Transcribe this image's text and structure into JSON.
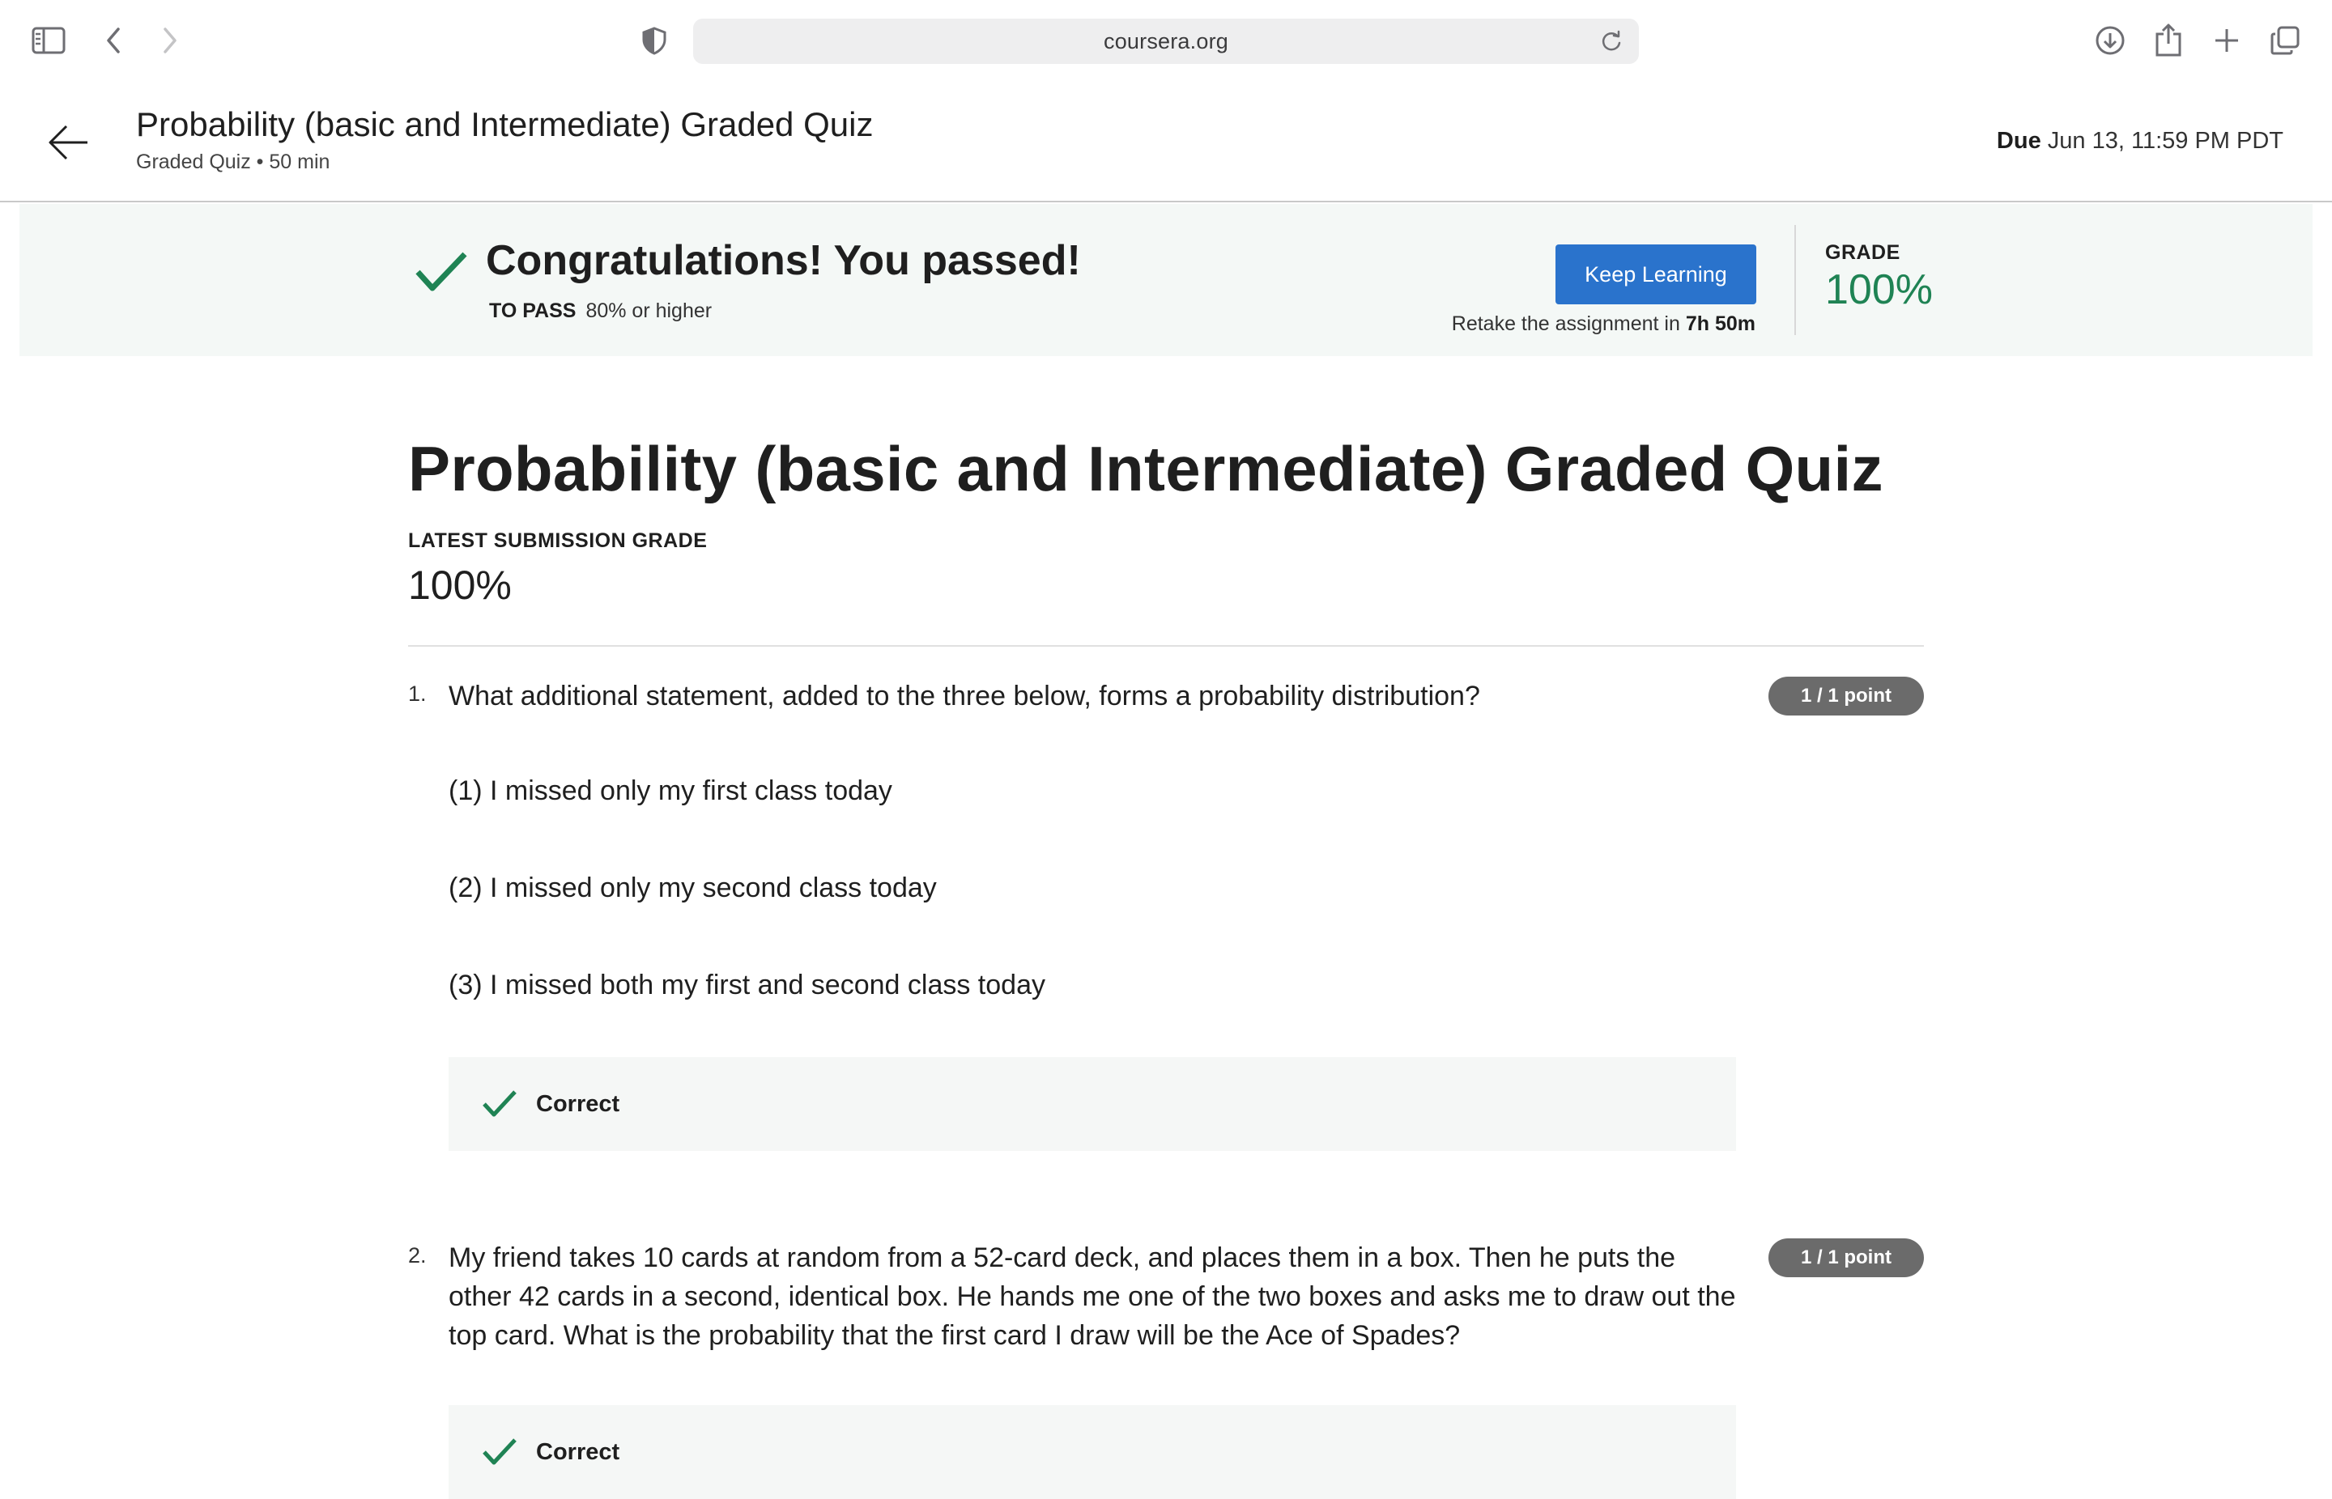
{
  "browser": {
    "url": "coursera.org",
    "icons": [
      "sidebar-icon",
      "back-icon",
      "forward-icon",
      "shield-icon",
      "reload-icon",
      "download-icon",
      "share-icon",
      "new-tab-icon",
      "tabs-overview-icon"
    ]
  },
  "header": {
    "title": "Probability (basic and Intermediate) Graded Quiz",
    "subtitle": "Graded Quiz • 50 min",
    "due_label": "Due",
    "due_value": "Jun 13, 11:59 PM PDT"
  },
  "banner": {
    "title": "Congratulations! You passed!",
    "to_pass_label": "TO PASS",
    "to_pass_value": "80% or higher",
    "button_label": "Keep Learning",
    "retake_text": "Retake the assignment in",
    "retake_time": "7h 50m",
    "grade_label": "GRADE",
    "grade_value": "100%",
    "accent_color": "#1f8354",
    "button_color": "#2a73cc"
  },
  "main": {
    "title": "Probability (basic and Intermediate) Graded Quiz",
    "latest_label": "LATEST SUBMISSION GRADE",
    "latest_value": "100%"
  },
  "questions": [
    {
      "number": "1.",
      "text": "What additional statement, added to the three below, forms a probability distribution?",
      "points": "1 / 1 point",
      "options": [
        "(1) I missed only my first class today",
        "(2) I missed only my second class today",
        "(3) I missed both my first and second class today"
      ],
      "feedback": "Correct"
    },
    {
      "number": "2.",
      "text": "My friend takes 10 cards at random from a 52-card deck, and places them in a box. Then he puts the other 42 cards in a second, identical box. He hands me one of the two boxes and asks me to draw out the top card. What is the probability that the first card I draw will be the Ace of Spades?",
      "points": "1 / 1 point",
      "feedback": "Correct"
    }
  ]
}
